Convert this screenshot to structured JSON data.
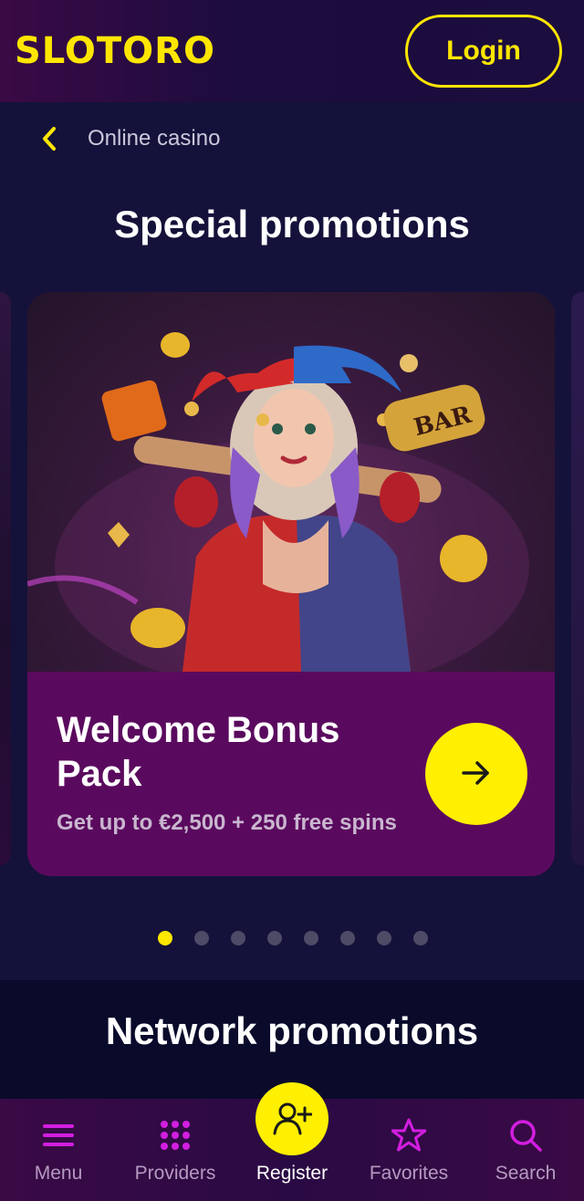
{
  "header": {
    "logo": "SLOTORO",
    "login_label": "Login"
  },
  "breadcrumb": {
    "label": "Online casino"
  },
  "special": {
    "title": "Special promotions"
  },
  "promo": {
    "title": "Welcome Bonus Pack",
    "subtitle": "Get up to €2,500 + 250 free spins",
    "image_name": "jester-girl-casino-art"
  },
  "carousel": {
    "dot_count": 8,
    "active_index": 0
  },
  "network": {
    "title": "Network promotions"
  },
  "bottom_nav": {
    "items": [
      {
        "label": "Menu",
        "icon": "menu-icon"
      },
      {
        "label": "Providers",
        "icon": "grid-icon"
      },
      {
        "label": "Register",
        "icon": "add-user-icon"
      },
      {
        "label": "Favorites",
        "icon": "star-icon"
      },
      {
        "label": "Search",
        "icon": "search-icon"
      }
    ]
  },
  "colors": {
    "accent": "#ffe600",
    "card_purple": "#5a0a5e",
    "bg": "#14123a",
    "nav_icon": "#d21ee0"
  }
}
